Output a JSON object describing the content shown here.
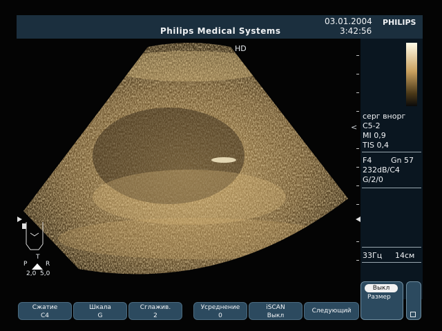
{
  "header": {
    "title": "Philips Medical Systems",
    "date": "03.01.2004",
    "time": "3:42:56",
    "brand": "PHILIPS"
  },
  "image": {
    "hd_label": "HD"
  },
  "right_panel": {
    "chevron": "<",
    "lines1": [
      "серг внорг",
      "C5-2",
      "MI 0,9",
      "TIS 0,4"
    ],
    "lines2": [
      "F4",
      "Gn 57",
      "232dB/C4",
      "G/2/0"
    ],
    "freq": "33Гц",
    "depth": "14см"
  },
  "body_marker": {
    "p": "P",
    "t": "T",
    "r": "R",
    "values": "2,0  5,0"
  },
  "softkeys": [
    {
      "label": "Сжатие",
      "value": "C4"
    },
    {
      "label": "Шкала",
      "value": "G"
    },
    {
      "label": "Сглажив.",
      "value": "2"
    },
    {
      "label": "Усреднение",
      "value": "0"
    },
    {
      "label": "iSCAN",
      "value": "Выкл"
    },
    {
      "label": "Следующий",
      "value": ""
    }
  ],
  "bottom_right": {
    "off": "Выкл",
    "size": "Размер"
  },
  "colors": {
    "header_bg": "#1b2f3e",
    "softkey_bg": "#2c4a5f",
    "echo_tint": "#c9a15f"
  }
}
